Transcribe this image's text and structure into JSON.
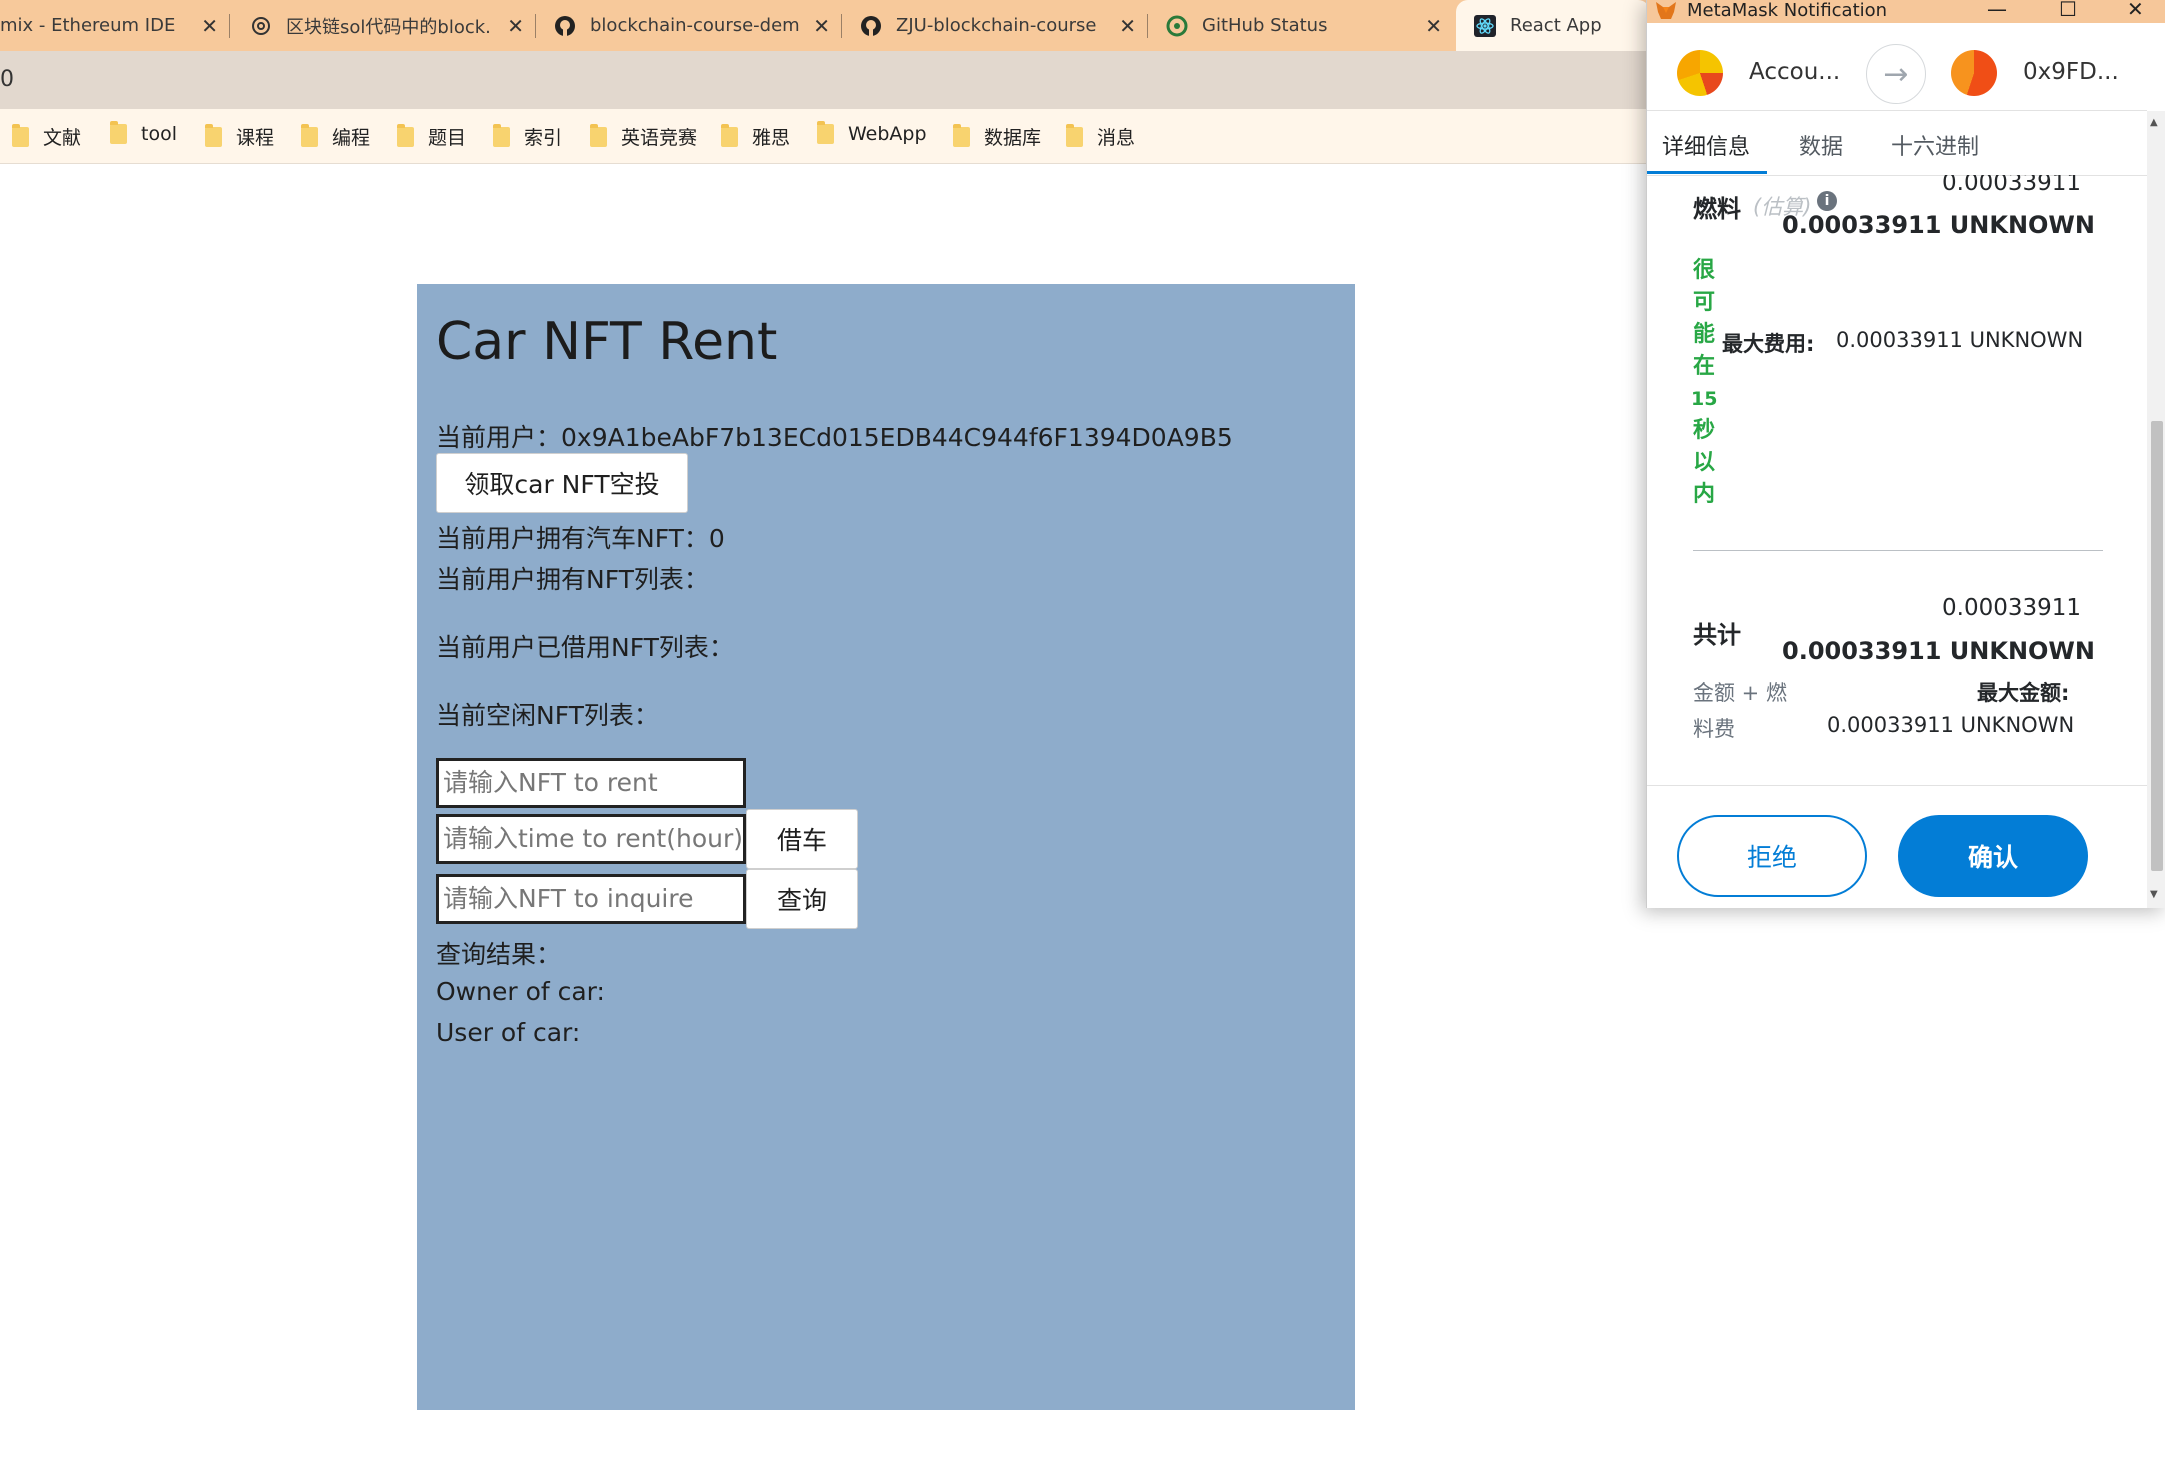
{
  "browser": {
    "tabs": [
      {
        "title": "mix - Ethereum IDE",
        "icon": "remix-icon",
        "active": false
      },
      {
        "title": "区块链sol代码中的block.",
        "icon": "openai-icon",
        "active": false
      },
      {
        "title": "blockchain-course-dem",
        "icon": "github-icon",
        "active": false
      },
      {
        "title": "ZJU-blockchain-course",
        "icon": "github-icon",
        "active": false
      },
      {
        "title": "GitHub Status",
        "icon": "github-status-icon",
        "active": false
      },
      {
        "title": "React App",
        "icon": "react-icon",
        "active": true
      }
    ],
    "url": "0",
    "bookmarks": [
      "文献",
      "tool",
      "课程",
      "编程",
      "题目",
      "索引",
      "英语竞赛",
      "雅思",
      "WebApp",
      "数据库",
      "消息"
    ]
  },
  "app": {
    "title": "Car NFT Rent",
    "current_user_label": "当前用户：",
    "current_user": "0x9A1beAbF7b13ECd015EDB44C944f6F1394D0A9B5",
    "airdrop_button": "领取car NFT空投",
    "owned_count_label": "当前用户拥有汽车NFT：",
    "owned_count": "0",
    "owned_list_label": "当前用户拥有NFT列表：",
    "borrowed_list_label": "当前用户已借用NFT列表：",
    "idle_list_label": "当前空闲NFT列表：",
    "nft_to_rent_placeholder": "请输入NFT to rent",
    "time_to_rent_placeholder": "请输入time to rent(hour)",
    "rent_button": "借车",
    "nft_to_inquire_placeholder": "请输入NFT to inquire",
    "inquire_button": "查询",
    "result_label": "查询结果：",
    "owner_label": "Owner of car:",
    "user_label": "User of car:"
  },
  "metamask": {
    "window_title": "MetaMask Notification",
    "from_account": "Accou...",
    "to_account": "0x9FD...",
    "tabs": [
      "详细信息",
      "数据",
      "十六进制"
    ],
    "gas_label": "燃料",
    "gas_estimate": "(估算)",
    "gas_value": "0.00033911",
    "gas_value_bold": "0.00033911 UNKNOWN",
    "likely_text": "很可能在15秒以内",
    "likely_chars": [
      "很",
      "可",
      "能",
      "在",
      "15",
      "秒",
      "以",
      "内"
    ],
    "max_fee_label": "最大费用:",
    "max_fee_value": "0.00033911 UNKNOWN",
    "total_label": "共计",
    "total_value": "0.00033911",
    "total_value_bold": "0.00033911 UNKNOWN",
    "amount_gas_label": "金额 + 燃",
    "fee_label": "料费",
    "max_amount_label": "最大金额:",
    "max_amount_value": "0.00033911 UNKNOWN",
    "reject_button": "拒绝",
    "confirm_button": "确认",
    "colors": {
      "accent": "#037dd6",
      "green": "#28a745"
    }
  }
}
